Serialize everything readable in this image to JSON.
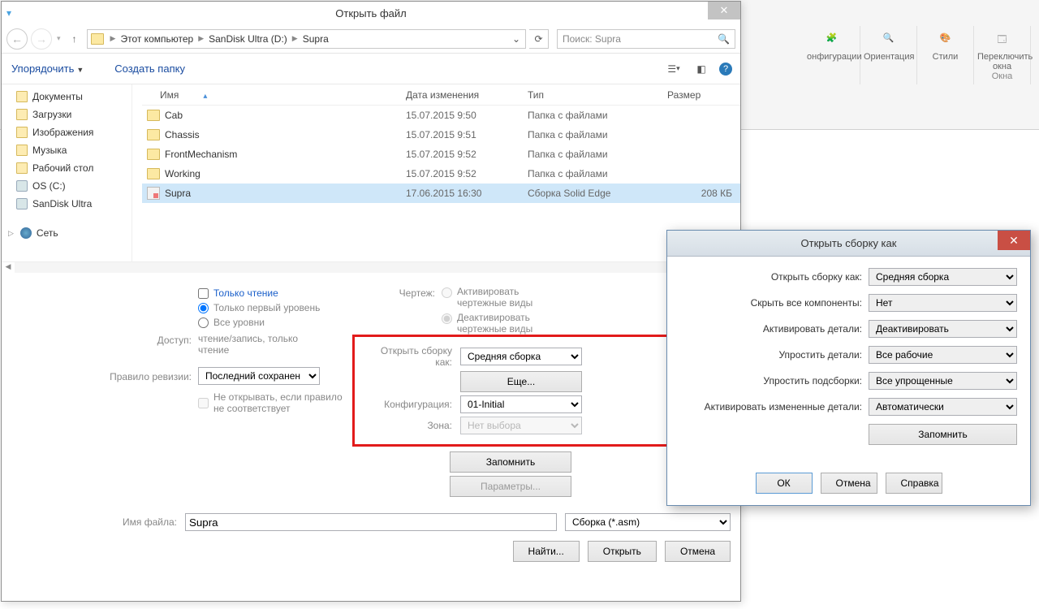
{
  "ribbon": {
    "items": [
      {
        "label": "онфигурации"
      },
      {
        "label": "Ориентация"
      },
      {
        "label": "Стили"
      },
      {
        "label": "Переключить окна"
      },
      {
        "sublabel": "Окна"
      }
    ]
  },
  "filedlg": {
    "title": "Открыть файл",
    "breadcrumb": [
      "Этот компьютер",
      "SanDisk Ultra (D:)",
      "Supra"
    ],
    "search_placeholder": "Поиск: Supra",
    "organize": "Упорядочить",
    "newfolder": "Создать папку",
    "tree": [
      {
        "label": "Документы",
        "icon": "folder"
      },
      {
        "label": "Загрузки",
        "icon": "folder"
      },
      {
        "label": "Изображения",
        "icon": "folder"
      },
      {
        "label": "Музыка",
        "icon": "folder"
      },
      {
        "label": "Рабочий стол",
        "icon": "folder"
      },
      {
        "label": "OS (C:)",
        "icon": "drive"
      },
      {
        "label": "SanDisk Ultra",
        "icon": "drive"
      }
    ],
    "tree_network": "Сеть",
    "cols": {
      "name": "Имя",
      "date": "Дата изменения",
      "type": "Тип",
      "size": "Размер"
    },
    "rows": [
      {
        "name": "Cab",
        "date": "15.07.2015 9:50",
        "type": "Папка с файлами",
        "size": "",
        "icon": "fold"
      },
      {
        "name": "Chassis",
        "date": "15.07.2015 9:51",
        "type": "Папка с файлами",
        "size": "",
        "icon": "fold"
      },
      {
        "name": "FrontMechanism",
        "date": "15.07.2015 9:52",
        "type": "Папка с файлами",
        "size": "",
        "icon": "fold"
      },
      {
        "name": "Working",
        "date": "15.07.2015 9:52",
        "type": "Папка с файлами",
        "size": "",
        "icon": "fold"
      },
      {
        "name": "Supra",
        "date": "17.06.2015 16:30",
        "type": "Сборка Solid Edge",
        "size": "208 КБ",
        "icon": "asm",
        "selected": true
      }
    ],
    "opts": {
      "readonly": "Только чтение",
      "firstlevel": "Только первый уровень",
      "alllevels": "Все уровни",
      "access_label": "Доступ:",
      "access_value": "чтение/запись, только чтение",
      "revision_label": "Правило ревизии:",
      "revision_value": "Последний сохранен",
      "dontopen": "Не открывать, если правило не соответствует",
      "drawing_label": "Чертеж:",
      "activate_views": "Активировать чертежные виды",
      "deactivate_views": "Деактивировать чертежные виды",
      "open_as_label": "Открыть сборку как:",
      "open_as_value": "Средняя сборка",
      "more_btn": "Еще...",
      "config_label": "Конфигурация:",
      "config_value": "01-Initial",
      "zone_label": "Зона:",
      "zone_value": "Нет выбора",
      "remember_btn": "Запомнить",
      "params_btn": "Параметры..."
    },
    "filename_label": "Имя файла:",
    "filename_value": "Supra",
    "filetype_value": "Сборка (*.asm)",
    "btn_find": "Найти...",
    "btn_open": "Открыть",
    "btn_cancel": "Отмена"
  },
  "dlg2": {
    "title": "Открыть сборку как",
    "rows": {
      "open_as": {
        "label": "Открыть сборку как:",
        "value": "Средняя сборка"
      },
      "hide_all": {
        "label": "Скрыть все компоненты:",
        "value": "Нет"
      },
      "activate_parts": {
        "label": "Активировать детали:",
        "value": "Деактивировать"
      },
      "simplify_parts": {
        "label": "Упростить детали:",
        "value": "Все рабочие"
      },
      "simplify_subs": {
        "label": "Упростить подсборки:",
        "value": "Все упрощенные"
      },
      "activate_changed": {
        "label": "Активировать измененные детали:",
        "value": "Автоматически"
      }
    },
    "remember": "Запомнить",
    "ok": "ОК",
    "cancel": "Отмена",
    "help": "Справка"
  }
}
